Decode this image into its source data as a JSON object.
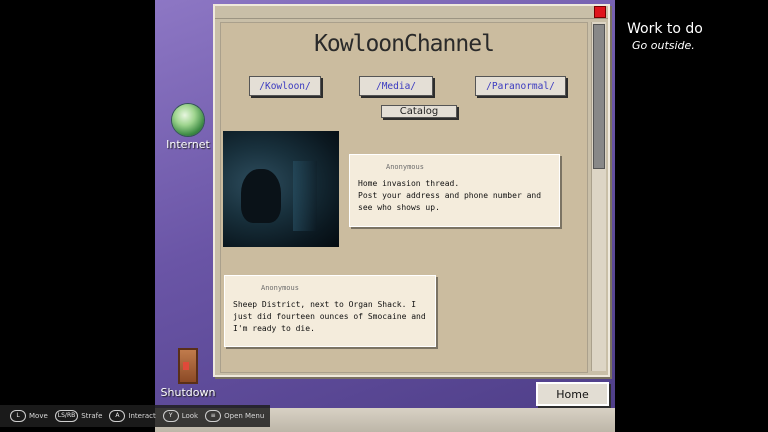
{
  "desktop": {
    "icons": [
      {
        "label": "Internet",
        "icon": "globe-icon"
      },
      {
        "label": "Shutdown",
        "icon": "door-icon"
      }
    ]
  },
  "browser": {
    "site_title": "KowloonChannel",
    "boards": [
      "/Kowloon/",
      "/Media/",
      "/Paranormal/"
    ],
    "catalog_label": "Catalog",
    "posts": [
      {
        "author": "Anonymous",
        "body": "Home invasion thread.\nPost your address and phone number and see who shows up."
      },
      {
        "author": "Anonymous",
        "body": "Sheep District, next to Organ Shack. I just did fourteen ounces of Smocaine and I'm ready to die."
      }
    ],
    "home_label": "Home"
  },
  "todo": {
    "heading": "Work to do",
    "item": "Go outside."
  },
  "controls": [
    {
      "key": "L",
      "label": "Move"
    },
    {
      "key": "LS/RB",
      "label": "Strafe"
    },
    {
      "key": "A",
      "label": "Interact"
    },
    {
      "key": "Y",
      "label": "Look"
    },
    {
      "key": "≡",
      "label": "Open Menu"
    }
  ],
  "colors": {
    "close_button": "#e0141c",
    "board_link": "#3a3ac0",
    "window_bg": "#c9bfa8"
  }
}
